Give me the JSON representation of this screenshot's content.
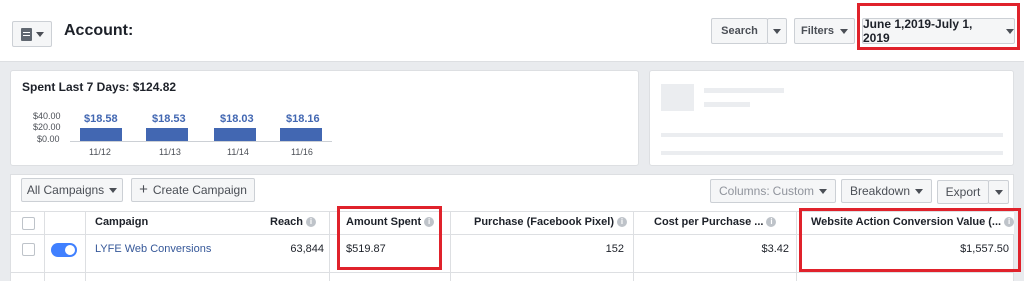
{
  "header": {
    "title": "Account:",
    "search_label": "Search",
    "filters_label": "Filters",
    "date_range": "June 1,2019-July 1, 2019"
  },
  "summary": {
    "spent_title": "Spent Last 7 Days: $124.82",
    "y_ticks": [
      "$40.00",
      "$20.00",
      "$0.00"
    ],
    "days": [
      {
        "date": "11/12",
        "value_label": "$18.58",
        "value": 18.58
      },
      {
        "date": "11/13",
        "value_label": "$18.53",
        "value": 18.53
      },
      {
        "date": "11/14",
        "value_label": "$18.03",
        "value": 18.03
      },
      {
        "date": "11/16",
        "value_label": "$18.16",
        "value": 18.16
      }
    ]
  },
  "toolbar": {
    "all_campaigns": "All Campaigns",
    "create_campaign": "Create Campaign",
    "columns_prefix": "Columns:",
    "columns_value": "Custom",
    "breakdown": "Breakdown",
    "export": "Export"
  },
  "table": {
    "headers": {
      "campaign": "Campaign",
      "reach": "Reach",
      "amount_spent": "Amount Spent",
      "purchase": "Purchase (Facebook Pixel)",
      "cost_per_purchase": "Cost per Purchase ...",
      "conversion_value": "Website Action Conversion Value (..."
    },
    "rows": [
      {
        "campaign": "LYFE Web Conversions",
        "reach": "63,844",
        "amount_spent": "$519.87",
        "purchase": "152",
        "cost_per_purchase": "$3.42",
        "conversion_value": "$1,557.50",
        "enabled": true
      }
    ]
  },
  "colors": {
    "accent": "#4267b2",
    "highlight": "#e0222b",
    "toggle_on": "#4080ff"
  }
}
